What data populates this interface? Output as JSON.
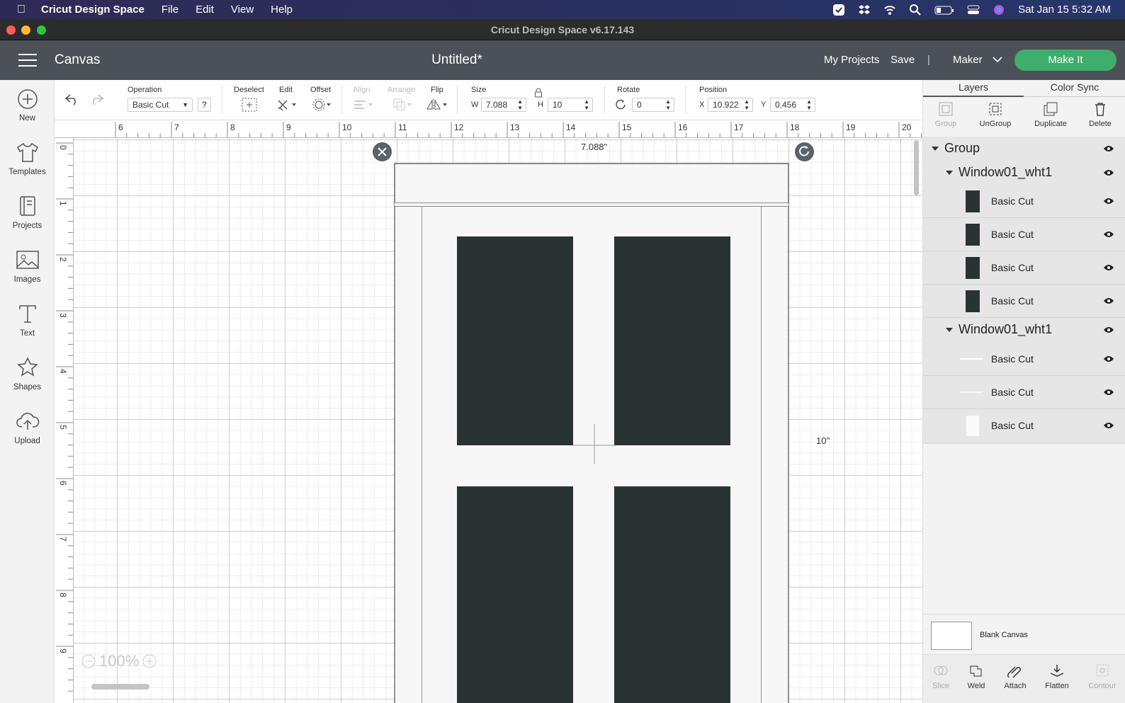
{
  "menubar": {
    "app_name": "Cricut Design Space",
    "items": [
      "File",
      "Edit",
      "View",
      "Help"
    ],
    "clock": "Sat Jan 15  5:32 AM"
  },
  "window": {
    "title": "Cricut Design Space  v6.17.143"
  },
  "header": {
    "section": "Canvas",
    "doc_title": "Untitled*",
    "my_projects": "My Projects",
    "save": "Save",
    "divider": "|",
    "machine": "Maker",
    "make_it": "Make It"
  },
  "sidebar": {
    "items": [
      {
        "label": "New",
        "icon": "plus-circle-icon"
      },
      {
        "label": "Templates",
        "icon": "tshirt-icon"
      },
      {
        "label": "Projects",
        "icon": "projects-icon"
      },
      {
        "label": "Images",
        "icon": "image-icon"
      },
      {
        "label": "Text",
        "icon": "text-icon"
      },
      {
        "label": "Shapes",
        "icon": "shapes-icon"
      },
      {
        "label": "Upload",
        "icon": "upload-cloud-icon"
      }
    ]
  },
  "toolbar": {
    "operation_label": "Operation",
    "operation_value": "Basic Cut",
    "help": "?",
    "deselect": "Deselect",
    "edit": "Edit",
    "offset": "Offset",
    "align": "Align",
    "arrange": "Arrange",
    "flip": "Flip",
    "size_label": "Size",
    "w_label": "W",
    "w_value": "7.088",
    "h_label": "H",
    "h_value": "10",
    "rotate_label": "Rotate",
    "rotate_value": "0",
    "position_label": "Position",
    "x_label": "X",
    "x_value": "10.922",
    "y_label": "Y",
    "y_value": "0.456"
  },
  "ruler": {
    "h_ticks": [
      "6",
      "7",
      "8",
      "9",
      "10",
      "11",
      "12",
      "13",
      "14",
      "15",
      "16",
      "17",
      "18",
      "19",
      "20"
    ],
    "v_ticks": [
      "0",
      "1",
      "2",
      "3",
      "4",
      "5",
      "6",
      "7",
      "8",
      "9"
    ]
  },
  "canvas": {
    "width_label": "7.088\"",
    "height_label": "10\"",
    "zoom": "100%"
  },
  "panel": {
    "tabs": [
      "Layers",
      "Color Sync"
    ],
    "actions": [
      {
        "label": "Group",
        "icon": "group-icon",
        "enabled": false
      },
      {
        "label": "UnGroup",
        "icon": "ungroup-icon",
        "enabled": true
      },
      {
        "label": "Duplicate",
        "icon": "duplicate-icon",
        "enabled": true
      },
      {
        "label": "Delete",
        "icon": "trash-icon",
        "enabled": true
      }
    ],
    "group_name": "Group",
    "subgroups": [
      {
        "name": "Window01_wht1",
        "layers": [
          "Basic Cut",
          "Basic Cut",
          "Basic Cut",
          "Basic Cut"
        ],
        "thumb_color": "#2a3333"
      },
      {
        "name": "Window01_wht1",
        "layers": [
          "Basic Cut",
          "Basic Cut",
          "Basic Cut"
        ],
        "thumb_color": "#ffffff"
      }
    ],
    "blank_canvas": "Blank Canvas",
    "bottom_actions": [
      {
        "label": "Slice",
        "icon": "slice-icon",
        "enabled": false
      },
      {
        "label": "Weld",
        "icon": "weld-icon",
        "enabled": true
      },
      {
        "label": "Attach",
        "icon": "attach-icon",
        "enabled": true
      },
      {
        "label": "Flatten",
        "icon": "flatten-icon",
        "enabled": true
      },
      {
        "label": "Contour",
        "icon": "contour-icon",
        "enabled": false
      }
    ]
  },
  "colors": {
    "accent": "#3fae6c",
    "header": "#4b5156",
    "pane": "#2a3333"
  }
}
